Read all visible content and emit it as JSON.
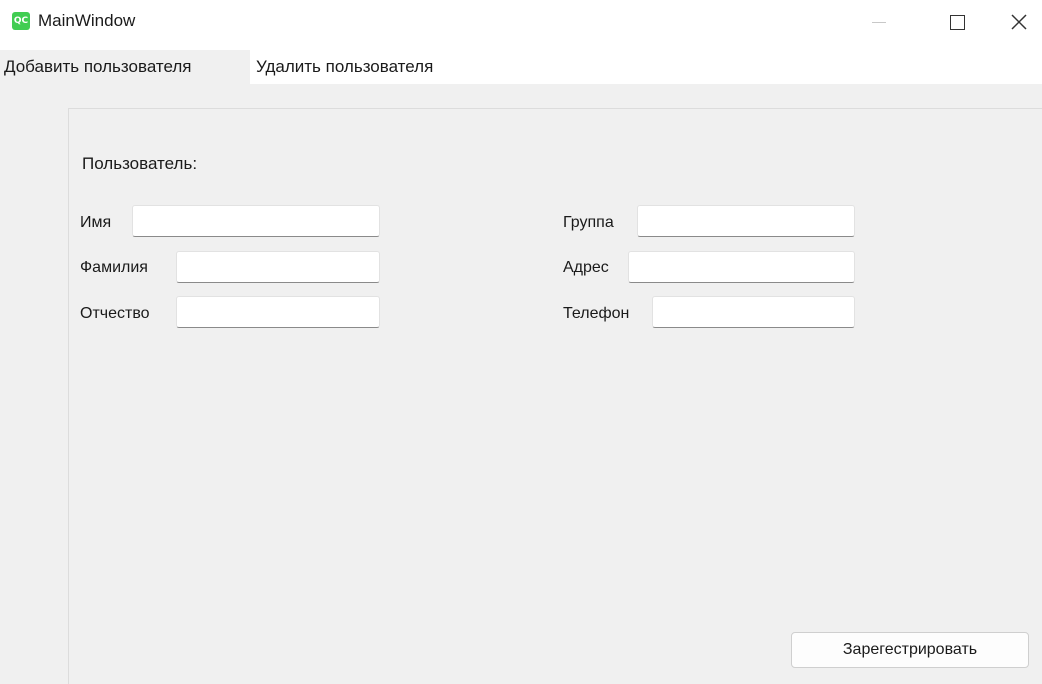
{
  "window": {
    "icon_text": "QC",
    "title": "MainWindow"
  },
  "tabs": [
    {
      "label": "Добавить пользователя",
      "active": true
    },
    {
      "label": "Удалить пользователя",
      "active": false
    }
  ],
  "form": {
    "section_label": "Пользователь:",
    "fields": {
      "first_name": {
        "label": "Имя",
        "value": ""
      },
      "last_name": {
        "label": "Фамилия",
        "value": ""
      },
      "patronymic": {
        "label": "Отчество",
        "value": ""
      },
      "group": {
        "label": "Группа",
        "value": ""
      },
      "address": {
        "label": "Адрес",
        "value": ""
      },
      "phone": {
        "label": "Телефон",
        "value": ""
      }
    },
    "submit_label": "Зарегестрировать"
  },
  "icons": {
    "app": "qt-app-icon",
    "minimize": "minimize-icon",
    "maximize": "maximize-icon",
    "close": "close-icon"
  },
  "colors": {
    "app_icon": "#41cd52",
    "panel_bg": "#f0f0f0"
  }
}
